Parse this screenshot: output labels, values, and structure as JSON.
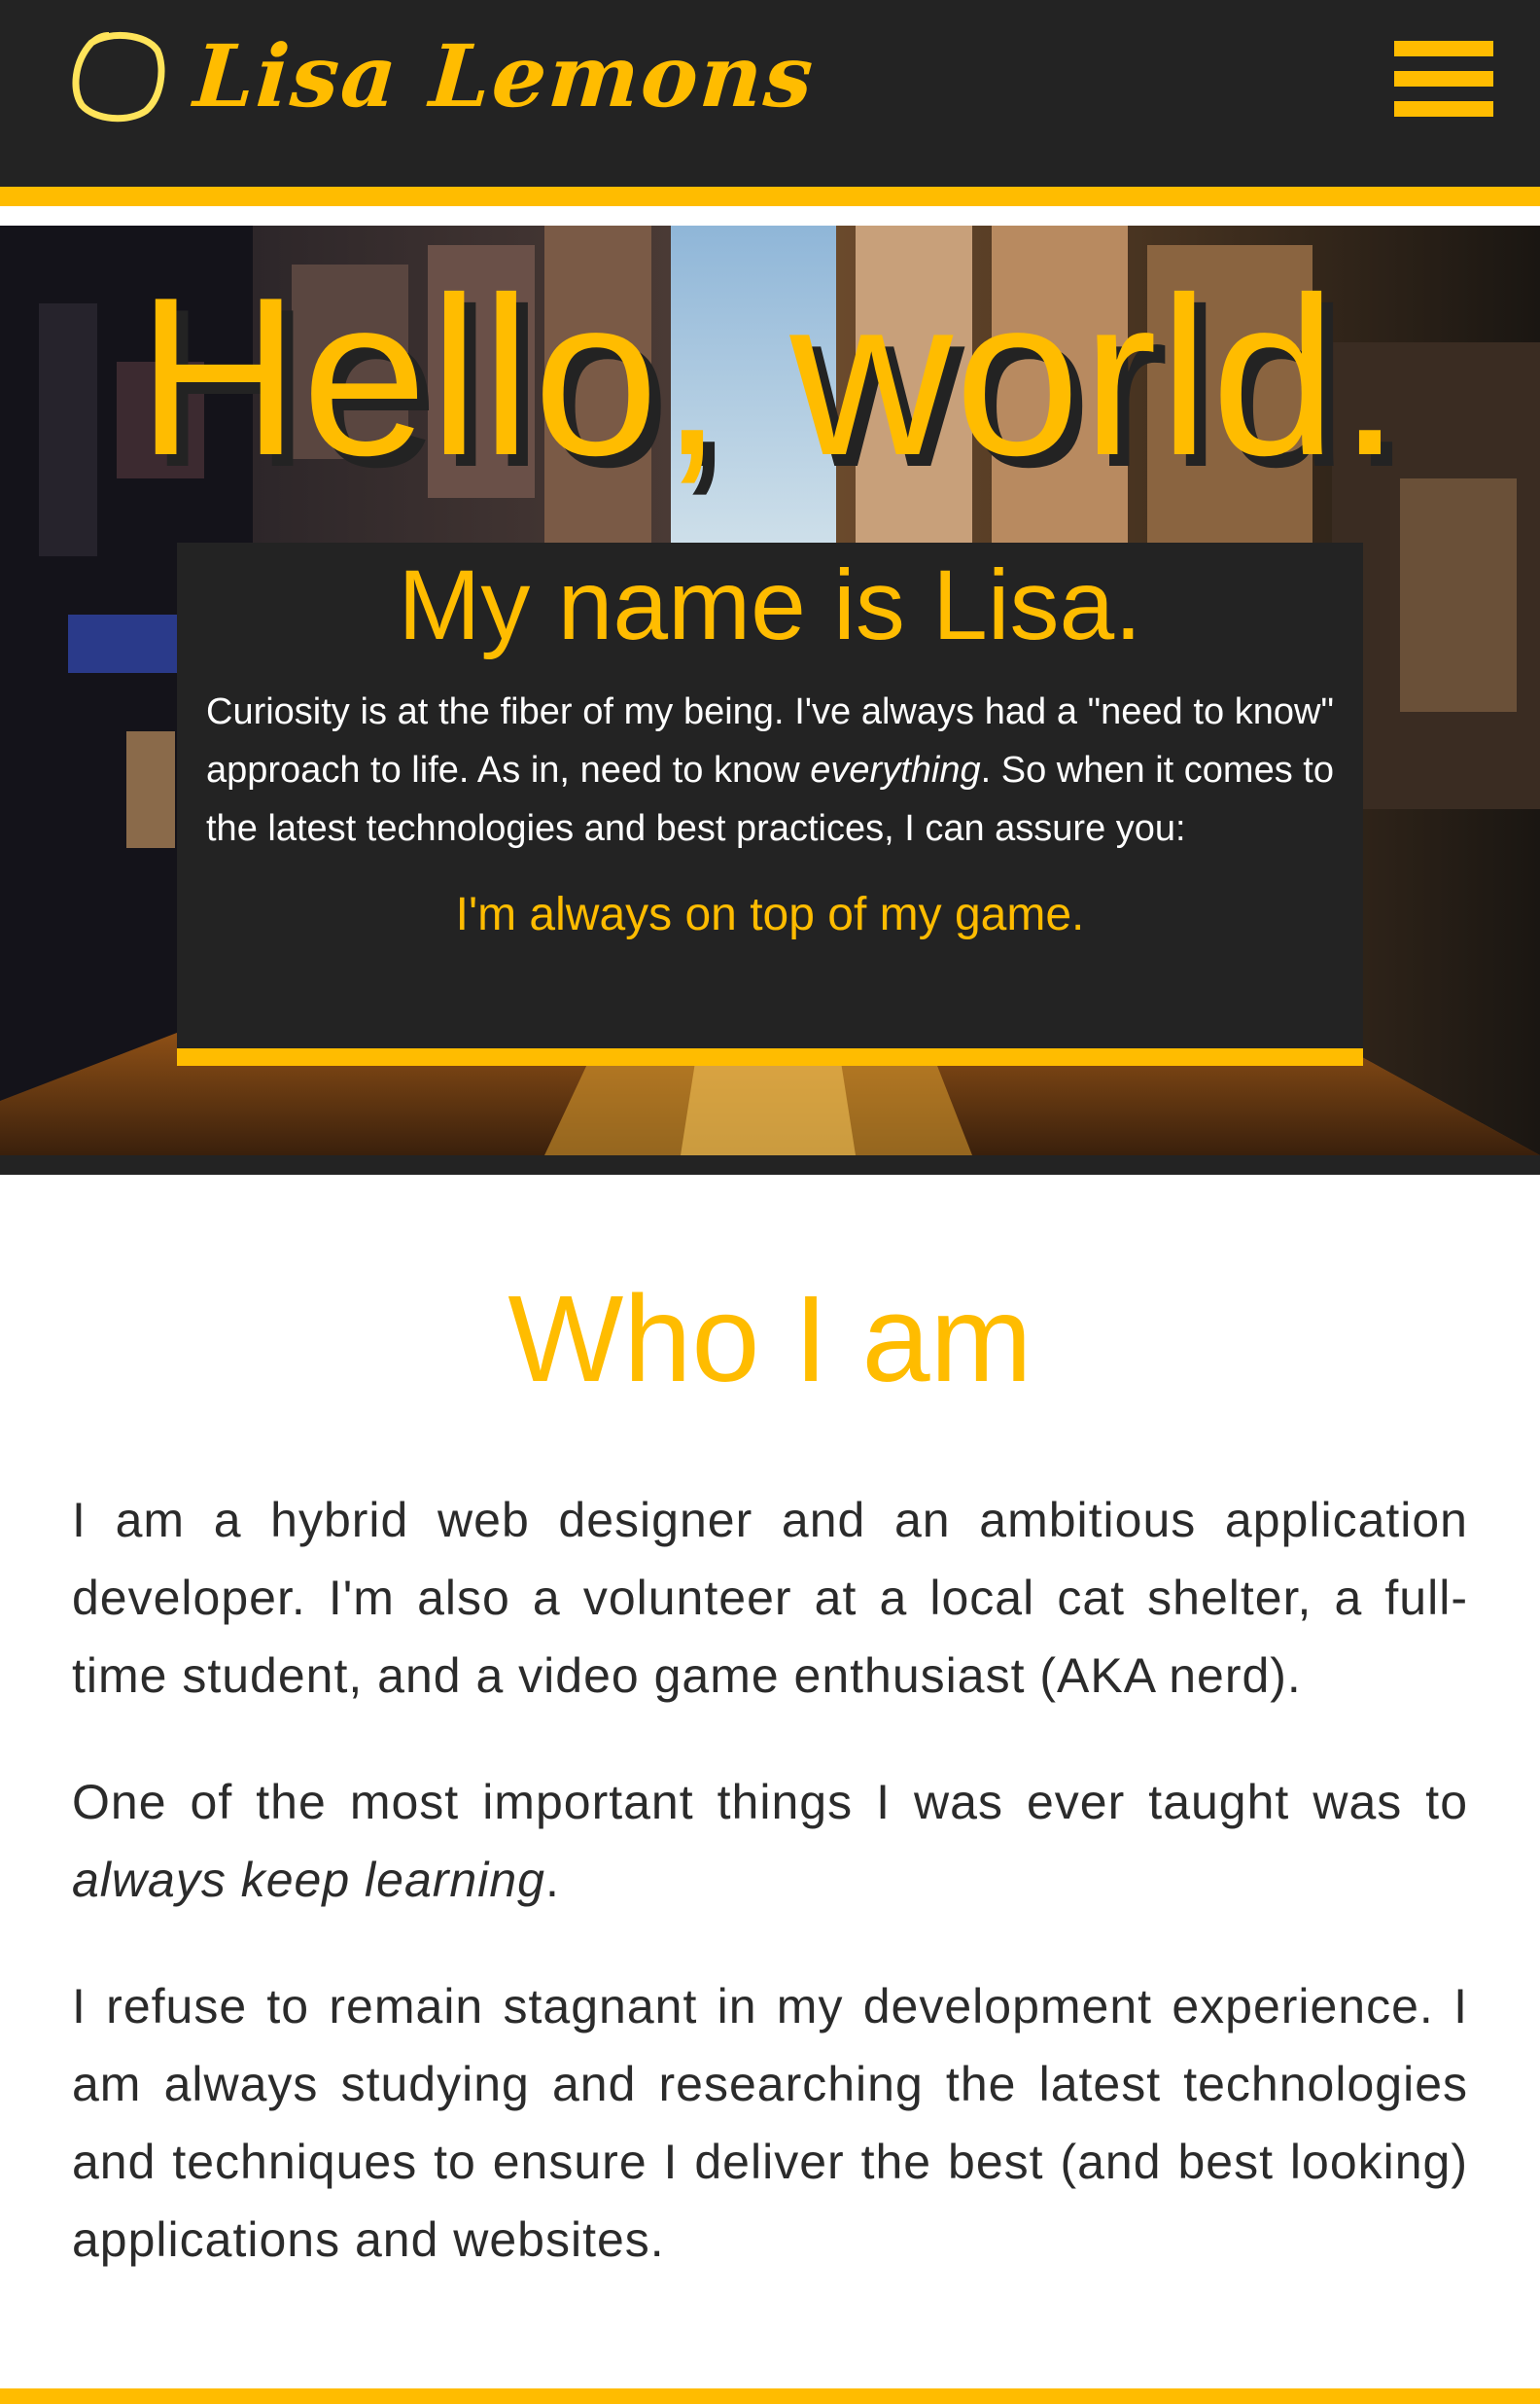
{
  "colors": {
    "accent": "#ffbc00",
    "dark": "#232323",
    "text": "#2b2b2b",
    "white": "#ffffff"
  },
  "header": {
    "brand_name": "Lisa Lemons",
    "logo_icon": "lemon-outline-icon",
    "menu_icon": "hamburger-menu-icon"
  },
  "hero": {
    "title": "Hello, world.",
    "background": "city-street-sunset-photo",
    "card": {
      "heading": "My name is Lisa.",
      "text_before_em": "Curiosity is at the fiber of my being. I've always had a \"need to know\" approach to life. As in, need to know ",
      "text_em": "everything",
      "text_after_em": ". So when it comes to the latest technologies and best practices, I can assure you:",
      "tagline": "I'm always on top of my game."
    }
  },
  "about": {
    "heading": "Who I am",
    "paragraph_1": "I am a hybrid web designer and an ambitious application developer. I'm also a volunteer at a local cat shelter, a full-time student, and a video game enthusiast (AKA nerd).",
    "paragraph_2_before_em": "One of the most important things I was ever taught was to ",
    "paragraph_2_em": "always keep learning",
    "paragraph_2_after_em": ".",
    "paragraph_3": "I refuse to remain stagnant in my development experience. I am always studying and researching the latest technologies and techniques to ensure I deliver the best (and best looking) applications and websites."
  }
}
